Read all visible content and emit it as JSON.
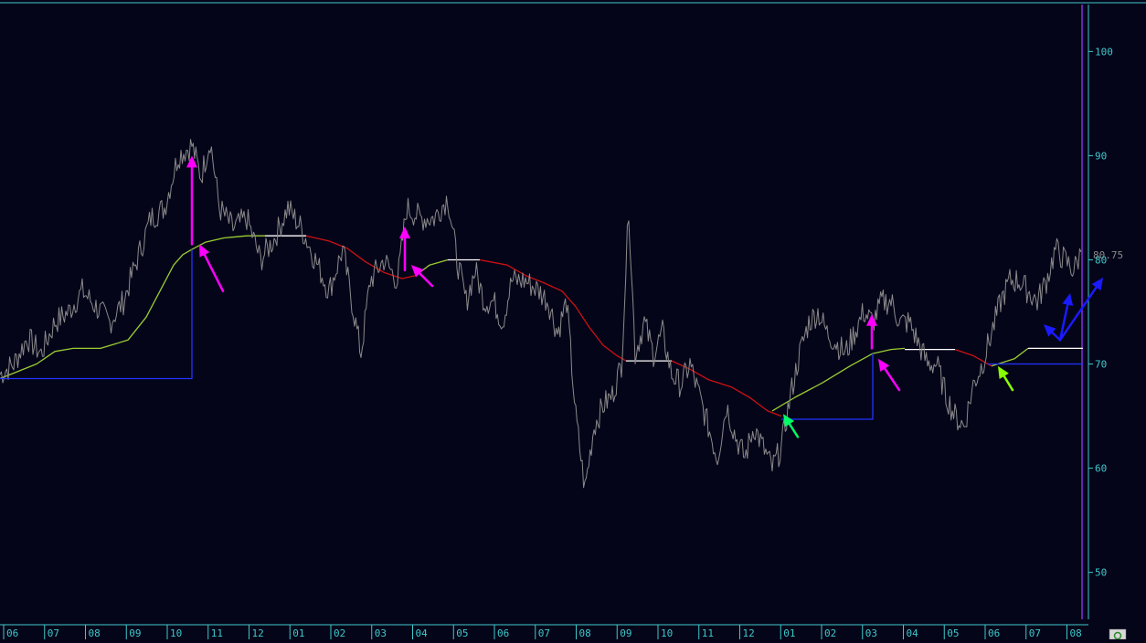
{
  "chart_data": {
    "type": "line",
    "y_axis": {
      "position": "right",
      "ticks": [
        50,
        60,
        70,
        80,
        90,
        100
      ],
      "ylim": [
        45.5,
        104.5
      ]
    },
    "x_axis": {
      "tick_labels": [
        "06",
        "07",
        "08",
        "09",
        "10",
        "11",
        "12",
        "01",
        "02",
        "03",
        "04",
        "05",
        "06",
        "07",
        "08",
        "09",
        "10",
        "11",
        "12",
        "01",
        "02",
        "03",
        "04",
        "05",
        "06",
        "07",
        "08"
      ]
    },
    "last_value_label": "80.75",
    "grid": false,
    "colors": {
      "background": "#05051a",
      "price": "#8a8a8a",
      "trend_up": "#9acd32",
      "trend_down": "#cc1111",
      "trend_flat": "#ffffff",
      "stop": "#2233ff",
      "axis_text": "#3ec9c9",
      "cursor_line": "#8a2be2",
      "arrow_magenta": "#ff00ff",
      "arrow_green": "#00ff66",
      "arrow_lime": "#88ff00",
      "arrow_blue": "#1a1aff"
    },
    "series": [
      {
        "role": "price",
        "points": [
          [
            0,
            69
          ],
          [
            15,
            70
          ],
          [
            30,
            72.5
          ],
          [
            45,
            71
          ],
          [
            60,
            74
          ],
          [
            75,
            75
          ],
          [
            90,
            77
          ],
          [
            105,
            75.5
          ],
          [
            120,
            74
          ],
          [
            135,
            76
          ],
          [
            150,
            80
          ],
          [
            165,
            84
          ],
          [
            180,
            85
          ],
          [
            195,
            90
          ],
          [
            210,
            91
          ],
          [
            220,
            88
          ],
          [
            230,
            91.5
          ],
          [
            240,
            85
          ],
          [
            255,
            83
          ],
          [
            270,
            84
          ],
          [
            285,
            80
          ],
          [
            300,
            82
          ],
          [
            315,
            85
          ],
          [
            330,
            83
          ],
          [
            345,
            80
          ],
          [
            360,
            77
          ],
          [
            375,
            81
          ],
          [
            385,
            76
          ],
          [
            395,
            71
          ],
          [
            405,
            78
          ],
          [
            420,
            80
          ],
          [
            435,
            78
          ],
          [
            445,
            85
          ],
          [
            460,
            84
          ],
          [
            475,
            84
          ],
          [
            490,
            86
          ],
          [
            500,
            80
          ],
          [
            510,
            76
          ],
          [
            520,
            79
          ],
          [
            530,
            76
          ],
          [
            540,
            76
          ],
          [
            550,
            74
          ],
          [
            560,
            78
          ],
          [
            575,
            78
          ],
          [
            590,
            77
          ],
          [
            600,
            76
          ],
          [
            610,
            73
          ],
          [
            620,
            76
          ],
          [
            630,
            65
          ],
          [
            640,
            58
          ],
          [
            650,
            64
          ],
          [
            660,
            66
          ],
          [
            670,
            67
          ],
          [
            680,
            70
          ],
          [
            688,
            85
          ],
          [
            695,
            71
          ],
          [
            705,
            74
          ],
          [
            715,
            71
          ],
          [
            725,
            73
          ],
          [
            735,
            69
          ],
          [
            745,
            68
          ],
          [
            755,
            70
          ],
          [
            765,
            67
          ],
          [
            775,
            64
          ],
          [
            785,
            61
          ],
          [
            795,
            66
          ],
          [
            805,
            63
          ],
          [
            815,
            61
          ],
          [
            825,
            64
          ],
          [
            835,
            62
          ],
          [
            845,
            60
          ],
          [
            855,
            62
          ],
          [
            865,
            67
          ],
          [
            875,
            71
          ],
          [
            885,
            74
          ],
          [
            895,
            75
          ],
          [
            905,
            73
          ],
          [
            915,
            72
          ],
          [
            925,
            71
          ],
          [
            935,
            73
          ],
          [
            945,
            75
          ],
          [
            955,
            74
          ],
          [
            965,
            76
          ],
          [
            975,
            76
          ],
          [
            985,
            74
          ],
          [
            995,
            74
          ],
          [
            1005,
            72
          ],
          [
            1015,
            70
          ],
          [
            1025,
            70
          ],
          [
            1035,
            67
          ],
          [
            1045,
            65
          ],
          [
            1055,
            64
          ],
          [
            1065,
            68
          ],
          [
            1075,
            70
          ],
          [
            1085,
            73
          ],
          [
            1095,
            76
          ],
          [
            1105,
            78
          ],
          [
            1115,
            78
          ],
          [
            1125,
            77
          ],
          [
            1135,
            76
          ],
          [
            1145,
            78
          ],
          [
            1155,
            81
          ],
          [
            1165,
            80
          ],
          [
            1175,
            79
          ],
          [
            1183,
            80.75
          ]
        ]
      },
      {
        "role": "trend_up",
        "points": [
          [
            0,
            68.6
          ],
          [
            20,
            69.3
          ],
          [
            40,
            70
          ],
          [
            60,
            71.2
          ],
          [
            80,
            71.5
          ],
          [
            110,
            71.5
          ],
          [
            140,
            72.3
          ],
          [
            160,
            74.5
          ],
          [
            175,
            77
          ],
          [
            190,
            79.5
          ],
          [
            200,
            80.5
          ],
          [
            210,
            81
          ],
          [
            225,
            81.7
          ],
          [
            245,
            82.1
          ],
          [
            270,
            82.3
          ],
          [
            290,
            82.3
          ]
        ]
      },
      {
        "role": "trend_flat",
        "points": [
          [
            290,
            82.3
          ],
          [
            335,
            82.3
          ]
        ]
      },
      {
        "role": "trend_down",
        "points": [
          [
            335,
            82.3
          ],
          [
            360,
            81.8
          ],
          [
            380,
            81.1
          ],
          [
            400,
            79.8
          ],
          [
            420,
            78.8
          ],
          [
            440,
            78.2
          ],
          [
            455,
            78.5
          ]
        ]
      },
      {
        "role": "trend_up",
        "points": [
          [
            455,
            78.5
          ],
          [
            470,
            79.5
          ],
          [
            490,
            80
          ]
        ]
      },
      {
        "role": "trend_flat",
        "points": [
          [
            490,
            80
          ],
          [
            525,
            80
          ]
        ]
      },
      {
        "role": "trend_down",
        "points": [
          [
            525,
            80
          ],
          [
            555,
            79.5
          ],
          [
            575,
            78.5
          ],
          [
            595,
            77.8
          ],
          [
            615,
            77
          ],
          [
            630,
            75.5
          ],
          [
            645,
            73.5
          ],
          [
            660,
            71.8
          ],
          [
            675,
            70.8
          ],
          [
            685,
            70.3
          ]
        ]
      },
      {
        "role": "trend_flat",
        "points": [
          [
            685,
            70.3
          ],
          [
            735,
            70.3
          ]
        ]
      },
      {
        "role": "trend_down",
        "points": [
          [
            735,
            70.3
          ],
          [
            755,
            69.5
          ],
          [
            775,
            68.5
          ],
          [
            800,
            67.8
          ],
          [
            820,
            66.8
          ],
          [
            840,
            65.5
          ],
          [
            855,
            65
          ]
        ]
      },
      {
        "role": "trend_up",
        "points": [
          [
            845,
            65.5
          ],
          [
            870,
            66.8
          ],
          [
            900,
            68.2
          ],
          [
            930,
            69.8
          ],
          [
            955,
            71
          ],
          [
            975,
            71.4
          ],
          [
            990,
            71.5
          ]
        ]
      },
      {
        "role": "trend_flat",
        "points": [
          [
            990,
            71.4
          ],
          [
            1045,
            71.4
          ]
        ]
      },
      {
        "role": "trend_down",
        "points": [
          [
            1045,
            71.4
          ],
          [
            1065,
            70.8
          ],
          [
            1085,
            69.8
          ]
        ]
      },
      {
        "role": "trend_up",
        "points": [
          [
            1085,
            69.8
          ],
          [
            1110,
            70.5
          ],
          [
            1125,
            71.5
          ]
        ]
      },
      {
        "role": "trend_flat",
        "points": [
          [
            1125,
            71.5
          ],
          [
            1185,
            71.5
          ]
        ]
      },
      {
        "role": "stop",
        "points": [
          [
            0,
            68.6
          ],
          [
            210,
            68.6
          ],
          [
            210,
            81
          ]
        ]
      },
      {
        "role": "stop",
        "points": [
          [
            855,
            64.7
          ],
          [
            955,
            64.7
          ],
          [
            955,
            71
          ]
        ]
      },
      {
        "role": "stop",
        "points": [
          [
            1080,
            70
          ],
          [
            1185,
            70
          ]
        ]
      }
    ],
    "arrows": [
      {
        "color": "arrow_magenta",
        "from": [
          210,
          81.5
        ],
        "to": [
          210,
          90
        ],
        "style": "long"
      },
      {
        "color": "arrow_magenta",
        "from": [
          244,
          77
        ],
        "to": [
          218,
          81.5
        ],
        "style": "diag"
      },
      {
        "color": "arrow_magenta",
        "from": [
          443,
          79
        ],
        "to": [
          443,
          83.2
        ],
        "style": "long"
      },
      {
        "color": "arrow_magenta",
        "from": [
          473,
          77.5
        ],
        "to": [
          450,
          79.5
        ],
        "style": "diag"
      },
      {
        "color": "arrow_magenta",
        "from": [
          954,
          71.5
        ],
        "to": [
          954,
          74.8
        ],
        "style": "long"
      },
      {
        "color": "arrow_magenta",
        "from": [
          984,
          67.5
        ],
        "to": [
          961,
          70.5
        ],
        "style": "diag"
      },
      {
        "color": "arrow_green",
        "from": [
          873,
          63
        ],
        "to": [
          857,
          65.2
        ],
        "style": "diag"
      },
      {
        "color": "arrow_lime",
        "from": [
          1108,
          67.5
        ],
        "to": [
          1092,
          69.8
        ],
        "style": "diag"
      },
      {
        "color": "arrow_blue",
        "from": [
          1160,
          72.3
        ],
        "to": [
          1142,
          73.8
        ],
        "style": "diag"
      },
      {
        "color": "arrow_blue",
        "from": [
          1160,
          72.3
        ],
        "to": [
          1171,
          76.8
        ],
        "style": "diag"
      },
      {
        "color": "arrow_blue",
        "from": [
          1160,
          72.3
        ],
        "to": [
          1207,
          78.3
        ],
        "style": "diag"
      }
    ]
  }
}
